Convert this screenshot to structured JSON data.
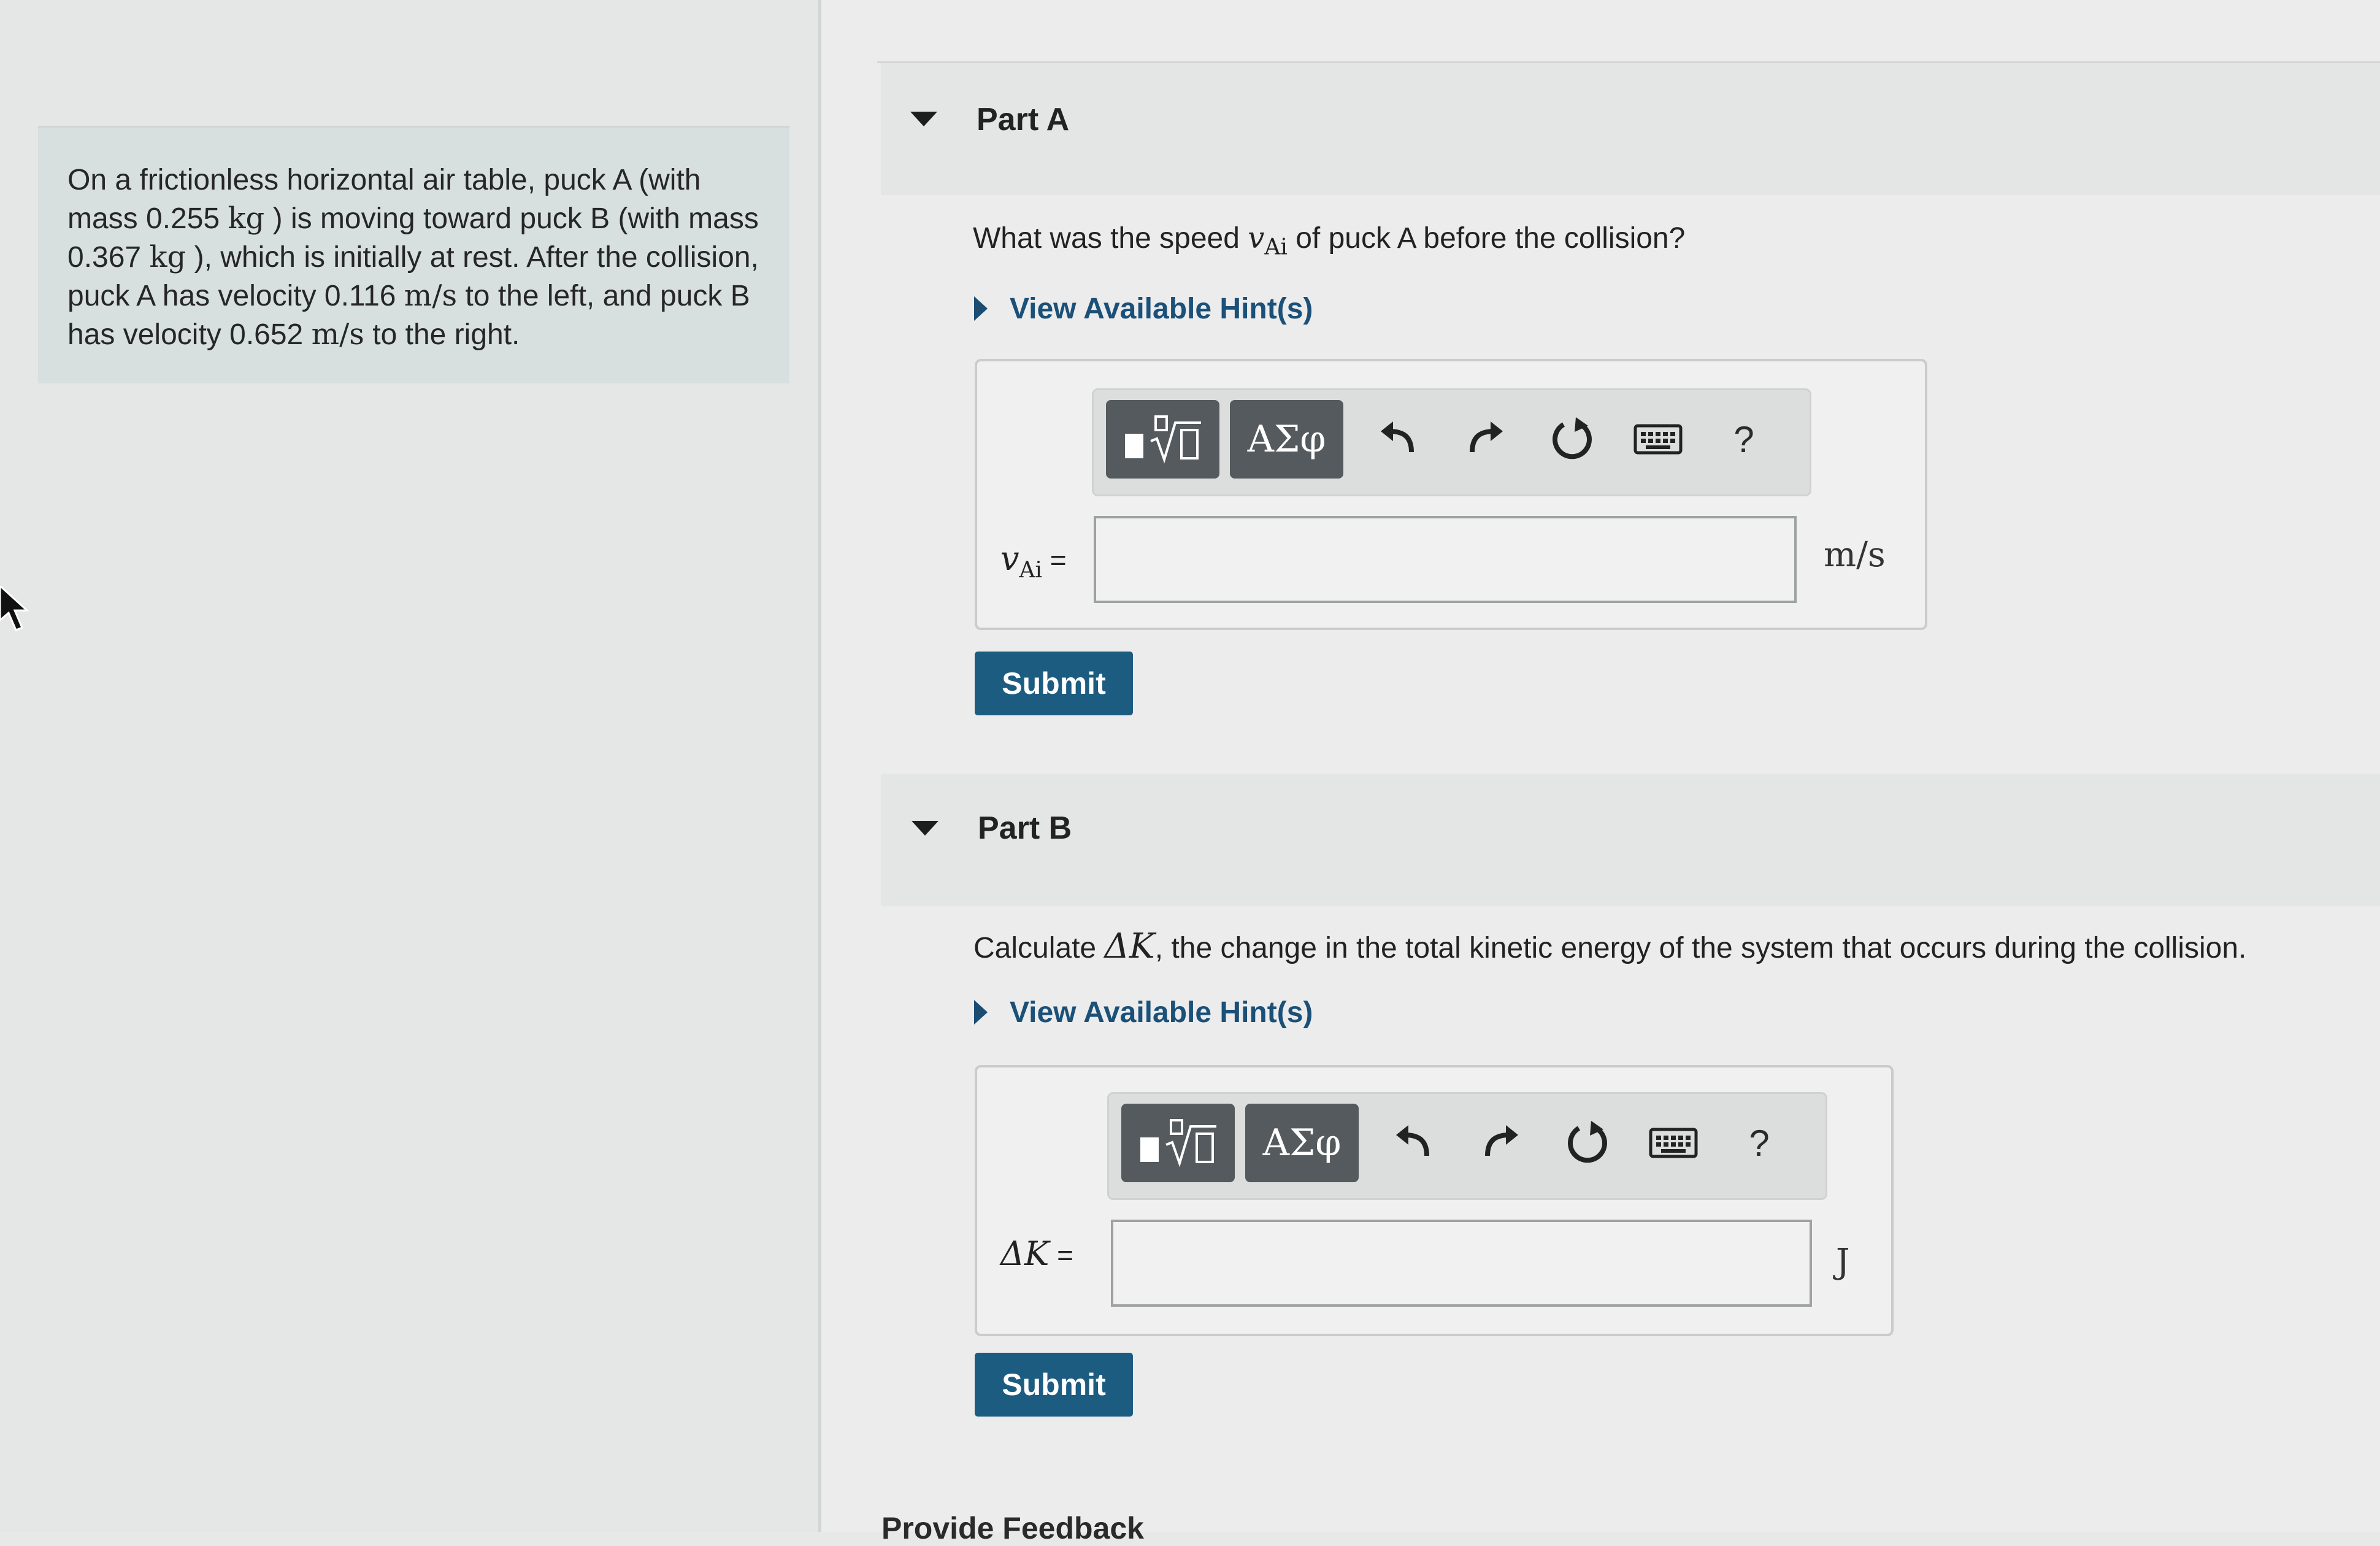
{
  "problem": {
    "text_parts": [
      "On a frictionless horizontal air table, puck A (with mass 0.255 ",
      "kg",
      " ) is moving toward puck B (with mass 0.367 ",
      "kg",
      " ), which is initially at rest. After the collision, puck A has velocity 0.116 ",
      "m/s",
      " to the left, and puck B has velocity 0.652 ",
      "m/s",
      " to the right."
    ]
  },
  "part_a": {
    "title": "Part A",
    "question_before": "What was the speed ",
    "question_var": "v",
    "question_sub": "Ai",
    "question_after": " of puck A before the collision?",
    "hint_link": "View Available Hint(s)",
    "var_label": "v",
    "var_sub": "Ai",
    "equals": " =",
    "input_value": "",
    "unit": "m/s",
    "submit_label": "Submit"
  },
  "part_b": {
    "title": "Part B",
    "question_before": "Calculate ",
    "question_var": "ΔK",
    "question_after": ", the change in the total kinetic energy of the system that occurs during the collision.",
    "hint_link": "View Available Hint(s)",
    "var_label": "ΔK",
    "equals": " =",
    "input_value": "",
    "unit": "J",
    "submit_label": "Submit"
  },
  "toolbar": {
    "greek_label": "ΑΣφ",
    "help_label": "?",
    "icons": [
      "templates-icon",
      "greek-symbols-icon",
      "undo-icon",
      "redo-icon",
      "reset-icon",
      "keyboard-icon",
      "help-icon"
    ]
  },
  "footer": {
    "feedback_link": "Provide Feedback"
  }
}
